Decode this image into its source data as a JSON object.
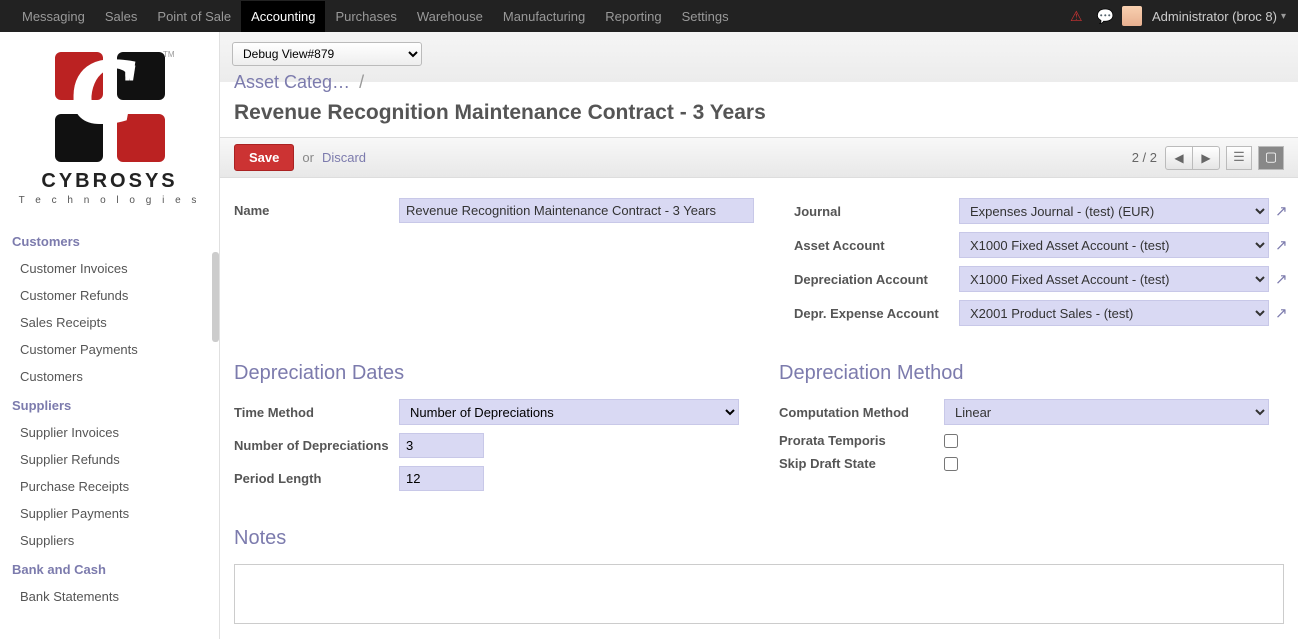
{
  "topnav": {
    "items": [
      "Messaging",
      "Sales",
      "Point of Sale",
      "Accounting",
      "Purchases",
      "Warehouse",
      "Manufacturing",
      "Reporting",
      "Settings"
    ],
    "active_index": 3,
    "user_label": "Administrator (broc  8)"
  },
  "logo": {
    "brand": "CYBROSYS",
    "sub": "T e c h n o l o g i e s"
  },
  "sidebar": {
    "sections": [
      {
        "title": "Customers",
        "items": [
          "Customer Invoices",
          "Customer Refunds",
          "Sales Receipts",
          "Customer Payments",
          "Customers"
        ]
      },
      {
        "title": "Suppliers",
        "items": [
          "Supplier Invoices",
          "Supplier Refunds",
          "Purchase Receipts",
          "Supplier Payments",
          "Suppliers"
        ]
      },
      {
        "title": "Bank and Cash",
        "items": [
          "Bank Statements"
        ]
      }
    ]
  },
  "debug_view": "Debug View#879",
  "breadcrumb": {
    "parent": "Asset Categ…",
    "sep": "/"
  },
  "page_title": "Revenue Recognition Maintenance Contract - 3 Years",
  "toolbar": {
    "save": "Save",
    "or": "or",
    "discard": "Discard",
    "pager": "2 / 2"
  },
  "form": {
    "name_label": "Name",
    "name_value": "Revenue Recognition Maintenance Contract - 3 Years",
    "journal_label": "Journal",
    "journal_value": "Expenses Journal - (test) (EUR)",
    "asset_account_label": "Asset Account",
    "asset_account_value": "X1000 Fixed Asset Account - (test)",
    "depr_account_label": "Depreciation Account",
    "depr_account_value": "X1000 Fixed Asset Account - (test)",
    "depr_expense_label": "Depr. Expense Account",
    "depr_expense_value": "X2001 Product Sales - (test)",
    "dates_heading": "Depreciation Dates",
    "time_method_label": "Time Method",
    "time_method_value": "Number of Depreciations",
    "num_depr_label": "Number of Depreciations",
    "num_depr_value": "3",
    "period_label": "Period Length",
    "period_value": "12",
    "method_heading": "Depreciation Method",
    "comp_method_label": "Computation Method",
    "comp_method_value": "Linear",
    "prorata_label": "Prorata Temporis",
    "skip_draft_label": "Skip Draft State",
    "notes_heading": "Notes"
  }
}
